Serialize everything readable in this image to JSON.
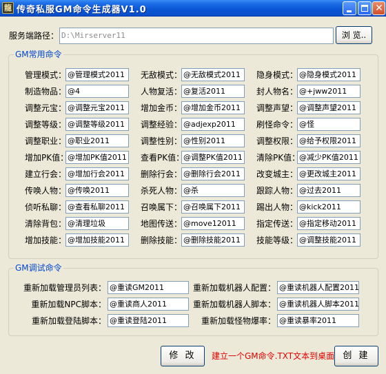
{
  "window": {
    "title": "传奇私服GM命令生成器V1.0",
    "icon_name": "app-icon",
    "controls": [
      "minimize",
      "maximize",
      "close"
    ]
  },
  "server": {
    "label": "服务端路径：",
    "value": "D:\\Mirserver11",
    "browse_label": "浏 览.."
  },
  "gm_commands": {
    "legend": "GM常用命令",
    "rows": [
      [
        {
          "label": "管理模式：",
          "value": "@管理模式2011"
        },
        {
          "label": "无敌模式：",
          "value": "@无敌模式2011"
        },
        {
          "label": "隐身模式：",
          "value": "@隐身模式2011"
        }
      ],
      [
        {
          "label": "制造物品：",
          "value": "@4"
        },
        {
          "label": "人物复活：",
          "value": "@复活2011"
        },
        {
          "label": "封人物名：",
          "value": "@+jww2011"
        }
      ],
      [
        {
          "label": "调整元宝：",
          "value": "@调整元宝2011"
        },
        {
          "label": "增加金币：",
          "value": "@增加金币2011"
        },
        {
          "label": "调整声望：",
          "value": "@调整声望2011"
        }
      ],
      [
        {
          "label": "调整等级：",
          "value": "@调整等级2011"
        },
        {
          "label": "调整经验：",
          "value": "@adjexp2011"
        },
        {
          "label": "刷怪命令：",
          "value": "@怪"
        }
      ],
      [
        {
          "label": "调整职业：",
          "value": "@职业2011"
        },
        {
          "label": "调整性别：",
          "value": "@性别2011"
        },
        {
          "label": "调整权限：",
          "value": "@给予权限2011"
        }
      ],
      [
        {
          "label": "增加PK值：",
          "value": "@增加PK值2011"
        },
        {
          "label": "查看PK值：",
          "value": "@调整PK值2011"
        },
        {
          "label": "清除PK值：",
          "value": "@减少PK值2011"
        }
      ],
      [
        {
          "label": "建立行会：",
          "value": "@增加行会2011"
        },
        {
          "label": "删除行会：",
          "value": "@删除行会2011"
        },
        {
          "label": "改变城主：",
          "value": "@更改城主2011"
        }
      ],
      [
        {
          "label": "传唤人物：",
          "value": "@传唤2011"
        },
        {
          "label": "杀死人物：",
          "value": "@杀"
        },
        {
          "label": "跟踪人物：",
          "value": "@过去2011"
        }
      ],
      [
        {
          "label": "侦听私聊：",
          "value": "@查看私聊2011"
        },
        {
          "label": "召唤属下：",
          "value": "@召唤属下2011"
        },
        {
          "label": "踢出人物：",
          "value": "@kick2011"
        }
      ],
      [
        {
          "label": "清除背包：",
          "value": "@清理垃圾"
        },
        {
          "label": "地图传送：",
          "value": "@move12011"
        },
        {
          "label": "指定传送：",
          "value": "@指定移动2011"
        }
      ],
      [
        {
          "label": "增加技能：",
          "value": "@增加技能2011"
        },
        {
          "label": "删除技能：",
          "value": "@删除技能2011"
        },
        {
          "label": "技能等级：",
          "value": "@调整技能2011"
        }
      ]
    ]
  },
  "gm_debug": {
    "legend": "GM调试命令",
    "rows": [
      [
        {
          "label": "重新加载管理员列表：",
          "value": "@重读GM2011"
        },
        {
          "label": "重新加载机器人配置：",
          "value": "@重读机器人配置2011"
        }
      ],
      [
        {
          "label": "重新加载NPC脚本：",
          "value": "@重读商人2011"
        },
        {
          "label": "重新加载机器人脚本：",
          "value": "@重读机器人脚本2011"
        }
      ],
      [
        {
          "label": "重新加载登陆脚本：",
          "value": "@重读登陆2011"
        },
        {
          "label": "重新加载怪物爆率：",
          "value": "@重读暴率2011"
        }
      ]
    ]
  },
  "footer": {
    "modify_label": "修 改",
    "note": "建立一个GM命令.TXT文本到桌面",
    "create_label": "创 建"
  },
  "colors": {
    "title_bar": "#0a56d6",
    "window_bg": "#ece9d8",
    "legend_text": "#0046d5",
    "note_text": "#e00000",
    "field_border": "#7f9db9"
  }
}
